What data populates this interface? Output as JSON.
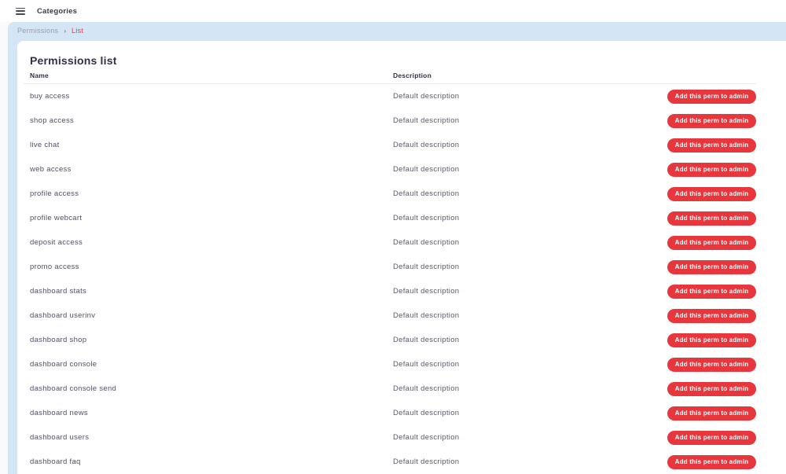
{
  "topbar": {
    "menu_icon": "hamburger-icon",
    "title": "Categories"
  },
  "breadcrumb": {
    "root": "Permissions",
    "separator": "›",
    "current": "List"
  },
  "page": {
    "title": "Permissions list"
  },
  "table": {
    "columns": {
      "name": "Name",
      "description": "Description"
    },
    "action_label": "Add this perm to admin",
    "rows": [
      {
        "name": "buy access",
        "description": "Default description"
      },
      {
        "name": "shop access",
        "description": "Default description"
      },
      {
        "name": "live chat",
        "description": "Default description"
      },
      {
        "name": "web access",
        "description": "Default description"
      },
      {
        "name": "profile access",
        "description": "Default description"
      },
      {
        "name": "profile webcart",
        "description": "Default description"
      },
      {
        "name": "deposit access",
        "description": "Default description"
      },
      {
        "name": "promo access",
        "description": "Default description"
      },
      {
        "name": "dashboard stats",
        "description": "Default description"
      },
      {
        "name": "dashboard userinv",
        "description": "Default description"
      },
      {
        "name": "dashboard shop",
        "description": "Default description"
      },
      {
        "name": "dashboard console",
        "description": "Default description"
      },
      {
        "name": "dashboard console send",
        "description": "Default description"
      },
      {
        "name": "dashboard news",
        "description": "Default description"
      },
      {
        "name": "dashboard users",
        "description": "Default description"
      },
      {
        "name": "dashboard faq",
        "description": "Default description"
      }
    ]
  },
  "colors": {
    "accent_red": "#e8363d",
    "breadcrumb_red": "#e23b55",
    "panel_blue": "#d4e5f5",
    "text_dark": "#30304a"
  }
}
